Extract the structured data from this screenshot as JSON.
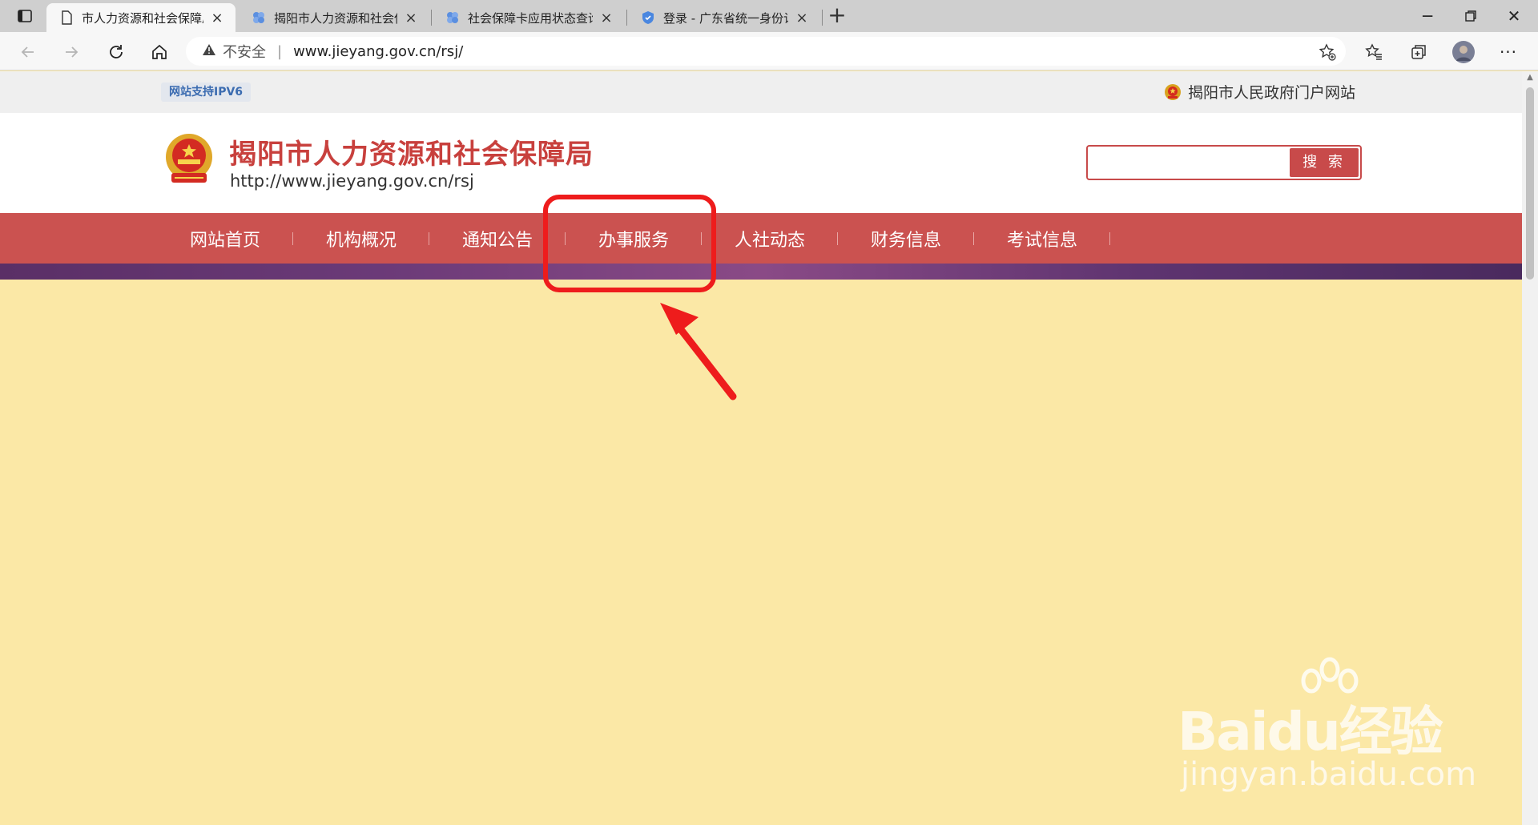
{
  "browser": {
    "tabs": [
      {
        "title": "市人力资源和社会保障局",
        "active": true
      },
      {
        "title": "揭阳市人力资源和社会保障局政",
        "active": false
      },
      {
        "title": "社会保障卡应用状态查询-广东政",
        "active": false
      },
      {
        "title": "登录 - 广东省统一身份认证平台",
        "active": false
      }
    ],
    "security_label": "不安全",
    "url": "www.jieyang.gov.cn/rsj/"
  },
  "page": {
    "ipv6_badge": "网站支持IPV6",
    "gov_portal_link": "揭阳市人民政府门户网站",
    "site_name": "揭阳市人力资源和社会保障局",
    "site_url": "http://www.jieyang.gov.cn/rsj",
    "search": {
      "placeholder": "",
      "button_label": "搜 索"
    },
    "nav": [
      {
        "label": "网站首页"
      },
      {
        "label": "机构概况"
      },
      {
        "label": "通知公告"
      },
      {
        "label": "办事服务"
      },
      {
        "label": "人社动态"
      },
      {
        "label": "财务信息"
      },
      {
        "label": "考试信息"
      }
    ]
  },
  "watermark": {
    "logo": "Baidu经验",
    "url": "jingyan.baidu.com"
  },
  "colors": {
    "brand_red": "#cb5250",
    "title_red": "#c8403d",
    "annotation_red": "#ee1c1c",
    "page_bg": "#fbe8a6"
  }
}
